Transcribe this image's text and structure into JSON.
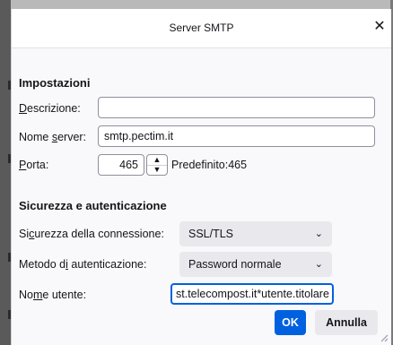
{
  "dialog": {
    "title": "Server SMTP",
    "close_symbol": "✕"
  },
  "settings": {
    "heading": "Impostazioni",
    "description": {
      "label_hot": "D",
      "label_rest": "escrizione:",
      "value": ""
    },
    "server_name": {
      "label_pre": "Nome ",
      "label_hot": "s",
      "label_rest": "erver:",
      "value": "smtp.pectim.it"
    },
    "port": {
      "label_hot": "P",
      "label_rest": "orta:",
      "value": "465",
      "default_text": "Predefinito:465"
    }
  },
  "security": {
    "heading": "Sicurezza e autenticazione",
    "connection_security": {
      "label_pre": "Si",
      "label_hot": "c",
      "label_rest": "urezza della connessione:",
      "selected": "SSL/TLS"
    },
    "auth_method": {
      "label_pre": "Metodo d",
      "label_hot": "i",
      "label_rest": " autenticazione:",
      "selected": "Password normale"
    },
    "username": {
      "label_pre": "No",
      "label_hot": "m",
      "label_rest": "e utente:",
      "value": "st.telecompost.it*utente.titolare"
    }
  },
  "buttons": {
    "ok": "OK",
    "cancel": "Annulla"
  }
}
